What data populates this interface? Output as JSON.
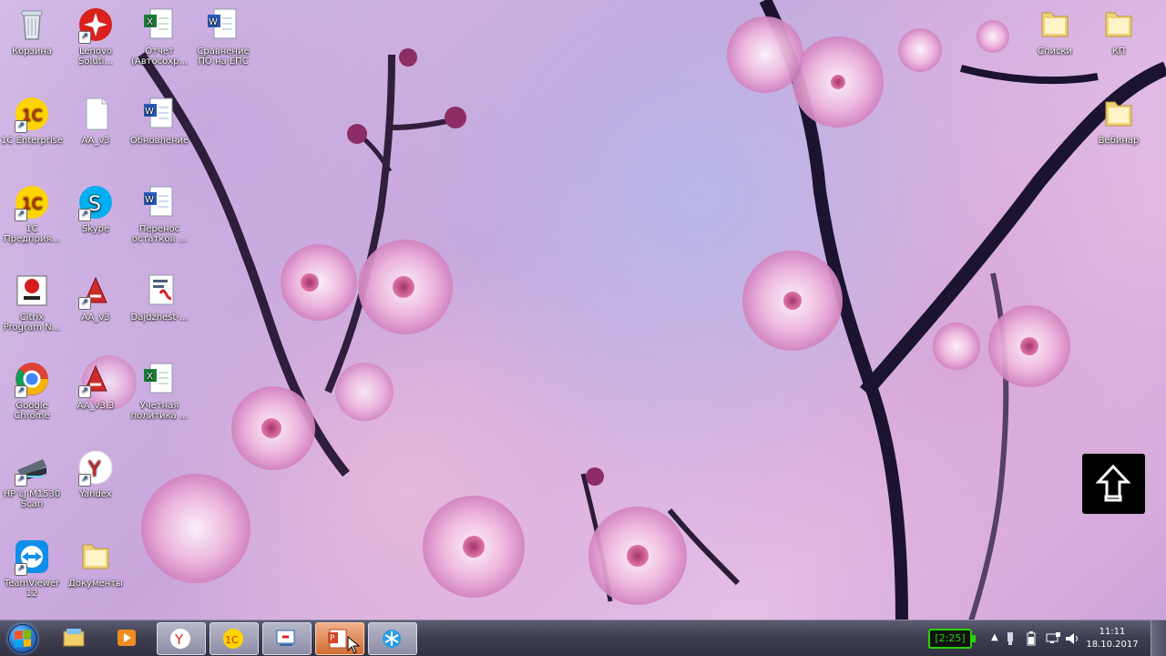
{
  "desktop": {
    "icons": [
      {
        "label": "Корзина"
      },
      {
        "label": "Lenovo\nSoluti..."
      },
      {
        "label": "Отчет\n(Автосохр..."
      },
      {
        "label": "Сравнение\nПО на ЕПС"
      },
      {
        "label": "1C Enterprise"
      },
      {
        "label": "AA_v3"
      },
      {
        "label": "Обновление"
      },
      {
        "label": "1С\nПредприя..."
      },
      {
        "label": "Skype"
      },
      {
        "label": "Перенос\nостатков ..."
      },
      {
        "label": "Citrix\nProgram N..."
      },
      {
        "label": "AA_v3"
      },
      {
        "label": "Dajdzhest-..."
      },
      {
        "label": "Google\nChrome"
      },
      {
        "label": "AA_v3.3"
      },
      {
        "label": "Учетная\nполитика ..."
      },
      {
        "label": "HP LJ M1530\nScan"
      },
      {
        "label": "Yandex"
      },
      {
        "label": "TeamViewer\n12"
      },
      {
        "label": "Документы"
      },
      {
        "label": "Списки"
      },
      {
        "label": "КП"
      },
      {
        "label": "Вебинар"
      }
    ]
  },
  "taskbar": {
    "battery_text": "[2:25]",
    "clock_time": "11:11",
    "clock_date": "18.10.2017"
  },
  "colors": {
    "taskbar": "#3f3f52",
    "battery": "#28d300",
    "wallpaper_accent": "#d9b7de"
  }
}
